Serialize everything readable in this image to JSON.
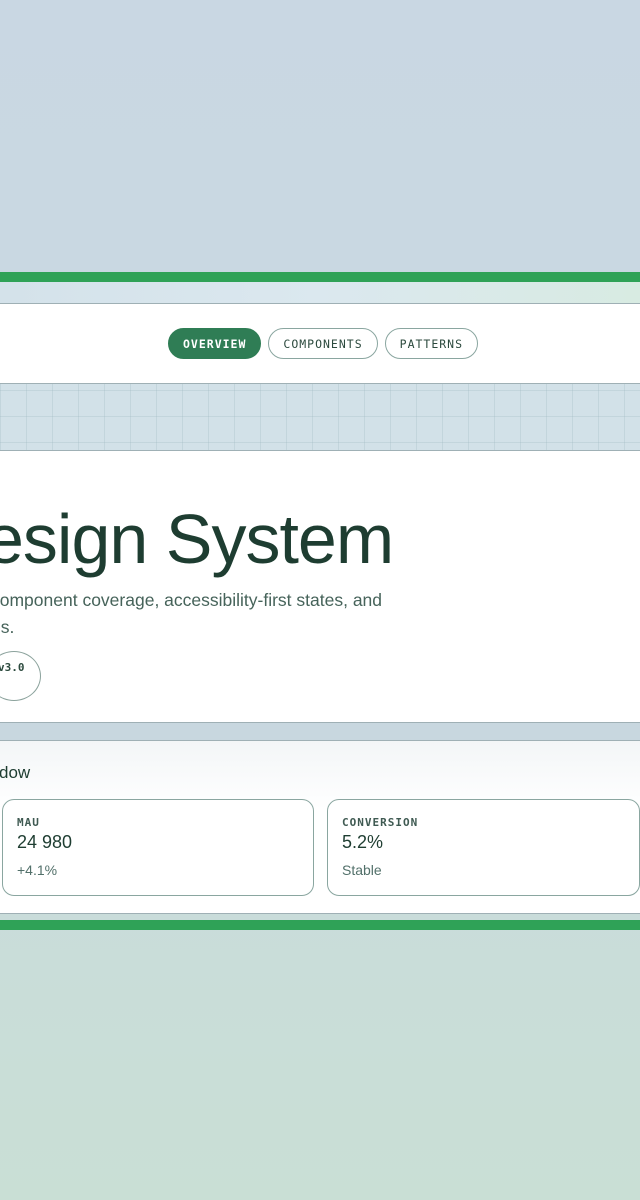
{
  "nav": {
    "tabs": [
      {
        "label": "OVERVIEW",
        "active": true
      },
      {
        "label": "COMPONENTS",
        "active": false
      },
      {
        "label": "PATTERNS",
        "active": false
      }
    ]
  },
  "hero": {
    "title": "esign System",
    "description_line1": "component coverage, accessibility-first states, and",
    "description_line2": "es.",
    "version": "v3.0"
  },
  "metrics": {
    "title": "dow",
    "cards": [
      {
        "label": "MAU",
        "value": "24 980",
        "sub": "+4.1%"
      },
      {
        "label": "CONVERSION",
        "value": "5.2%",
        "sub": "Stable"
      }
    ]
  },
  "colors": {
    "accent_green": "#2fa257",
    "active_tab": "#2f7d55",
    "heading_text": "#1e3d31",
    "card_border": "#8aa6a0"
  }
}
